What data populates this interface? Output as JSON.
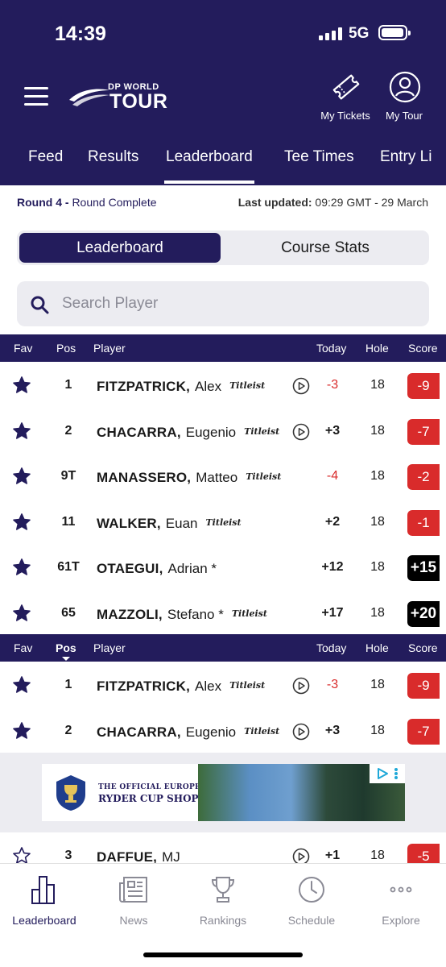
{
  "status_bar": {
    "time": "14:39",
    "network": "5G"
  },
  "header": {
    "logo_top": "DP WORLD",
    "logo_bottom": "TOUR",
    "my_tickets": "My Tickets",
    "my_tour": "My Tour"
  },
  "tabs": [
    "Feed",
    "Results",
    "Leaderboard",
    "Tee Times",
    "Entry Li"
  ],
  "active_tab": "Leaderboard",
  "round_info": {
    "round": "Round 4 -",
    "status": "Round Complete"
  },
  "updated": {
    "label": "Last updated:",
    "value": "09:29 GMT - 29 March"
  },
  "toggle": {
    "active": "Leaderboard",
    "other": "Course Stats"
  },
  "search": {
    "placeholder": "Search Player"
  },
  "columns": {
    "fav": "Fav",
    "pos": "Pos",
    "player": "Player",
    "today": "Today",
    "hole": "Hole",
    "score": "Score"
  },
  "favourites": [
    {
      "pos": "1",
      "last": "FITZPATRICK,",
      "first": "Alex",
      "brand": "Titleist",
      "live": true,
      "today": "-3",
      "hole": "18",
      "score": "-9",
      "score_style": "red"
    },
    {
      "pos": "2",
      "last": "CHACARRA,",
      "first": "Eugenio",
      "brand": "Titleist",
      "live": true,
      "today": "+3",
      "hole": "18",
      "score": "-7",
      "score_style": "red"
    },
    {
      "pos": "9T",
      "last": "MANASSERO,",
      "first": "Matteo",
      "brand": "Titleist",
      "live": false,
      "today": "-4",
      "hole": "18",
      "score": "-2",
      "score_style": "red"
    },
    {
      "pos": "11",
      "last": "WALKER,",
      "first": "Euan",
      "brand": "Titleist",
      "live": false,
      "today": "+2",
      "hole": "18",
      "score": "-1",
      "score_style": "red"
    },
    {
      "pos": "61T",
      "last": "OTAEGUI,",
      "first": "Adrian *",
      "brand": "",
      "live": false,
      "today": "+12",
      "hole": "18",
      "score": "+15",
      "score_style": "black"
    },
    {
      "pos": "65",
      "last": "MAZZOLI,",
      "first": "Stefano *",
      "brand": "Titleist",
      "live": false,
      "today": "+17",
      "hole": "18",
      "score": "+20",
      "score_style": "black"
    }
  ],
  "leaderboard": [
    {
      "pos": "1",
      "last": "FITZPATRICK,",
      "first": "Alex",
      "brand": "Titleist",
      "live": true,
      "today": "-3",
      "hole": "18",
      "score": "-9",
      "score_style": "red",
      "fav": true
    },
    {
      "pos": "2",
      "last": "CHACARRA,",
      "first": "Eugenio",
      "brand": "Titleist",
      "live": true,
      "today": "+3",
      "hole": "18",
      "score": "-7",
      "score_style": "red",
      "fav": true
    },
    {
      "pos": "3",
      "last": "DAFFUE,",
      "first": "MJ",
      "brand": "",
      "live": true,
      "today": "+1",
      "hole": "18",
      "score": "-5",
      "score_style": "red",
      "fav": false
    }
  ],
  "ad": {
    "line1": "THE OFFICIAL EUROPEAN",
    "line2": "RYDER CUP SHOP"
  },
  "bottom_nav": [
    "Leaderboard",
    "News",
    "Rankings",
    "Schedule",
    "Explore"
  ],
  "colors": {
    "navy": "#231c5c",
    "red": "#d92b2b",
    "black": "#000000",
    "grey_bg": "#ececf1"
  }
}
